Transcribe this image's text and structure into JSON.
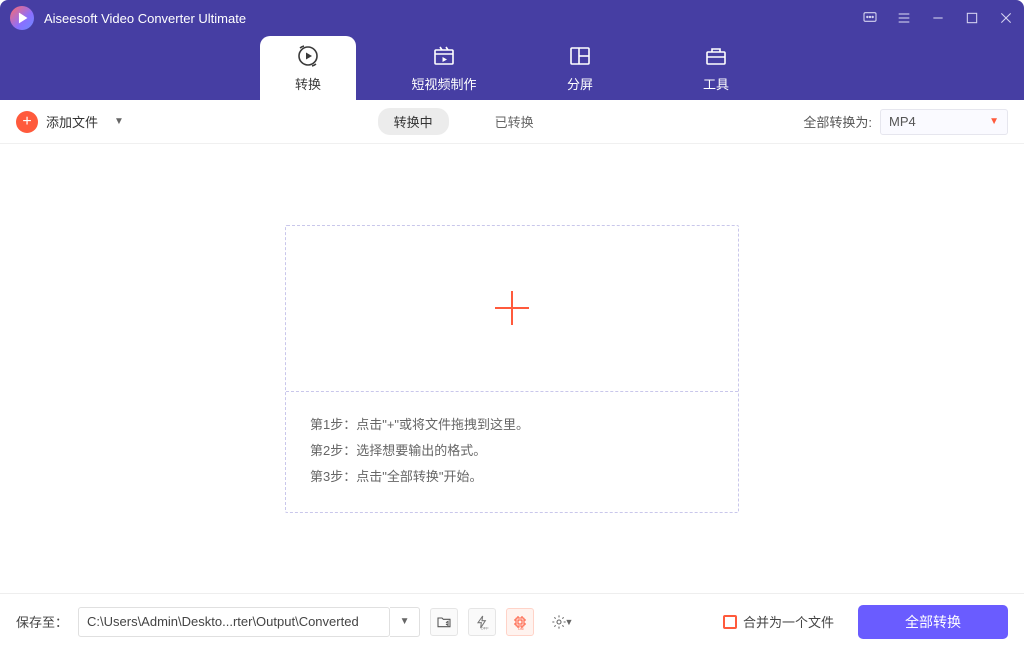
{
  "app_title": "Aiseesoft Video Converter Ultimate",
  "top_tabs": {
    "convert": "转换",
    "mv": "短视频制作",
    "collage": "分屏",
    "toolbox": "工具"
  },
  "toolbar": {
    "add_file": "添加文件",
    "converting": "转换中",
    "converted": "已转换",
    "convert_all_label": "全部转换为:",
    "format": "MP4"
  },
  "steps": {
    "s1": "第1步：点击\"+\"或将文件拖拽到这里。",
    "s2": "第2步：选择想要输出的格式。",
    "s3": "第3步：点击\"全部转换\"开始。"
  },
  "bottom": {
    "save_to": "保存至：",
    "path": "C:\\Users\\Admin\\Deskto...rter\\Output\\Converted",
    "merge_label": "合并为一个文件",
    "convert_all_btn": "全部转换"
  }
}
